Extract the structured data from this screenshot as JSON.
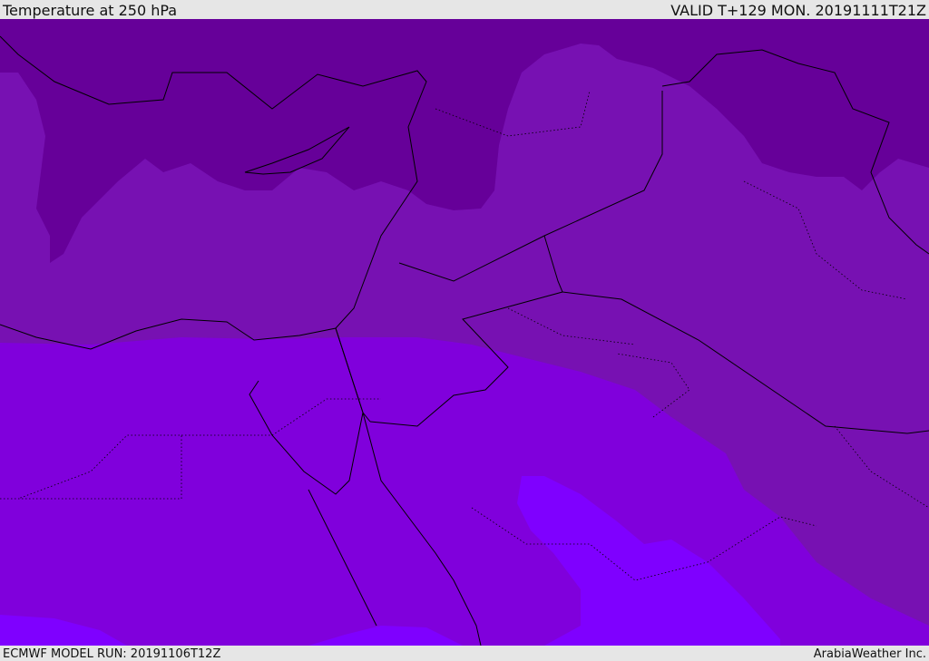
{
  "header": {
    "title": "Temperature at 250 hPa",
    "valid": "VALID T+129 MON. 20191111T21Z"
  },
  "footer": {
    "model_run": "ECMWF MODEL RUN: 20191106T12Z",
    "credit": "ArabiaWeather Inc."
  },
  "colors": {
    "darkest": "#660099",
    "dark": "#7711b2",
    "mid": "#8000dc",
    "bright": "#7f00ff"
  }
}
